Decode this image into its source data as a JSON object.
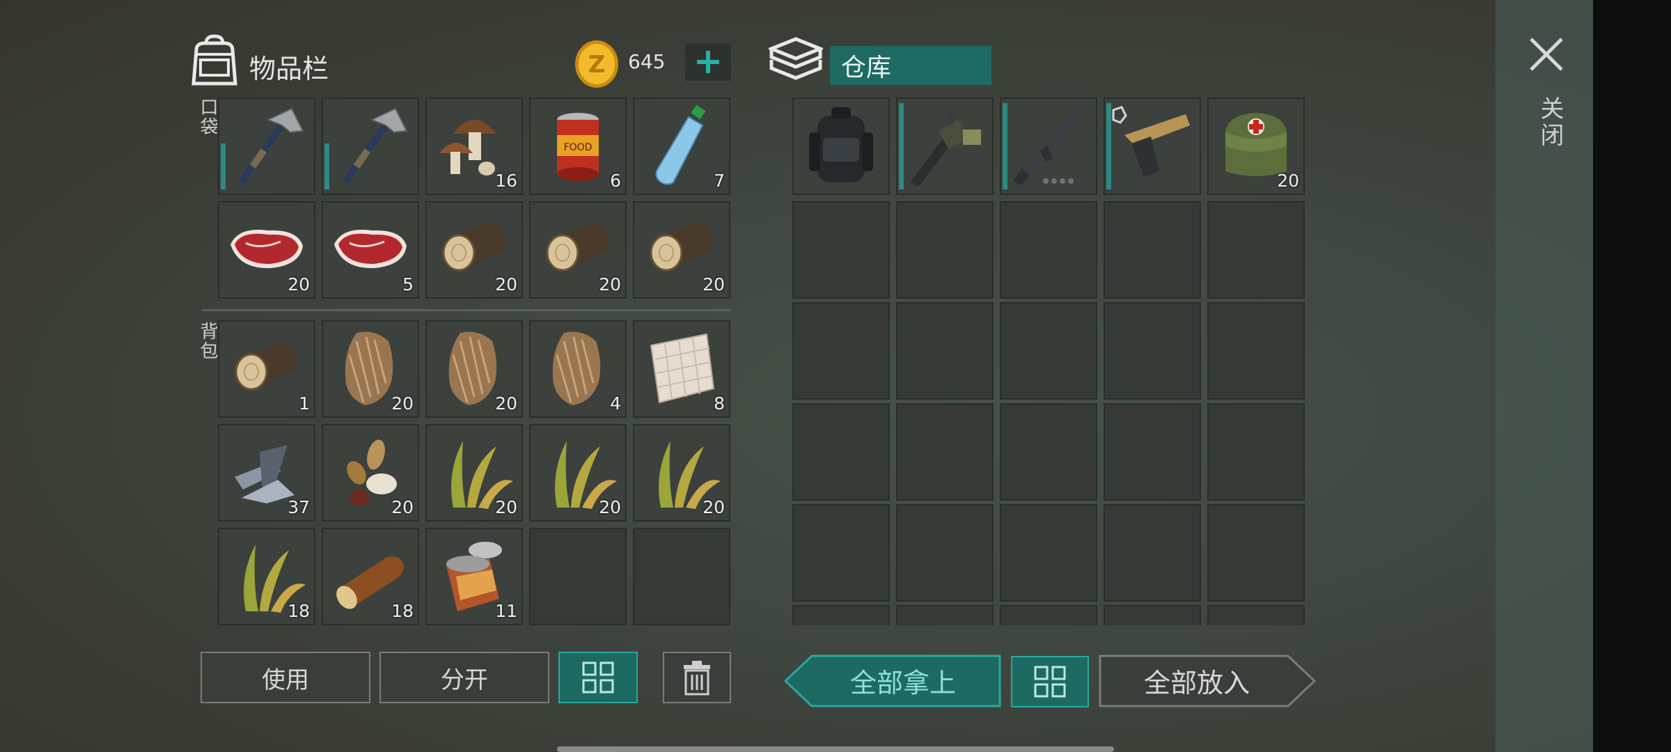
{
  "inventory": {
    "title": "物品栏",
    "coins": "645",
    "pocket_label": "口袋",
    "backpack_label": "背包",
    "pocket_items": [
      {
        "name": "hatchet",
        "qty": "",
        "durability": "half"
      },
      {
        "name": "hatchet",
        "qty": "",
        "durability": "half"
      },
      {
        "name": "mushrooms",
        "qty": "16"
      },
      {
        "name": "canned-food",
        "qty": "6"
      },
      {
        "name": "water-bottle",
        "qty": "7"
      },
      {
        "name": "raw-meat",
        "qty": "20"
      },
      {
        "name": "raw-meat",
        "qty": "5"
      },
      {
        "name": "wood-log",
        "qty": "20"
      },
      {
        "name": "wood-log",
        "qty": "20"
      },
      {
        "name": "wood-log",
        "qty": "20"
      }
    ],
    "backpack_items": [
      {
        "name": "wood-log",
        "qty": "1"
      },
      {
        "name": "fur",
        "qty": "20"
      },
      {
        "name": "fur",
        "qty": "20"
      },
      {
        "name": "fur",
        "qty": "4"
      },
      {
        "name": "cloth",
        "qty": "8"
      },
      {
        "name": "iron-scraps",
        "qty": "37"
      },
      {
        "name": "seeds",
        "qty": "20"
      },
      {
        "name": "plant-fiber",
        "qty": "20"
      },
      {
        "name": "plant-fiber",
        "qty": "20"
      },
      {
        "name": "plant-fiber",
        "qty": "20"
      },
      {
        "name": "plant-fiber",
        "qty": "18"
      },
      {
        "name": "wooden-stick",
        "qty": "18"
      },
      {
        "name": "opened-can",
        "qty": "11"
      },
      {
        "name": "empty",
        "qty": ""
      },
      {
        "name": "empty",
        "qty": ""
      }
    ]
  },
  "storage": {
    "title": "仓库",
    "items": [
      {
        "name": "backpack",
        "qty": ""
      },
      {
        "name": "grenade-launcher",
        "qty": "",
        "durability": "full"
      },
      {
        "name": "assault-rifle",
        "qty": "",
        "durability": "full"
      },
      {
        "name": "pistol",
        "qty": "",
        "durability": "full"
      },
      {
        "name": "medkit-bag",
        "qty": "20"
      }
    ]
  },
  "buttons": {
    "use": "使用",
    "split": "分开",
    "take_all": "全部拿上",
    "put_all": "全部放入"
  },
  "close_label": "关闭",
  "colors": {
    "accent": "#1d6a63",
    "accent_border": "#2aa89e",
    "coin": "#e0a820"
  }
}
